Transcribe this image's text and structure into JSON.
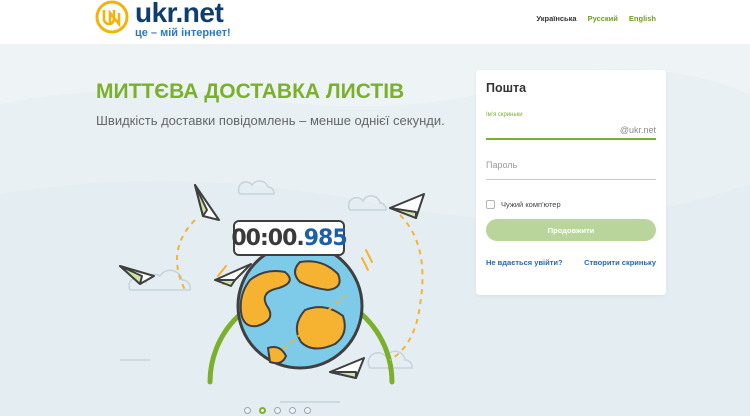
{
  "header": {
    "logo_word": "ukr.net",
    "slogan": "це – мій інтернет!",
    "languages": [
      {
        "label": "Українська",
        "current": true
      },
      {
        "label": "Русский",
        "current": false
      },
      {
        "label": "English",
        "current": false
      }
    ]
  },
  "promo": {
    "title": "МИТТЄВА ДОСТАВКА ЛИСТІВ",
    "subtitle": "Швидкість доставки повідомлень – менше однієї секунди.",
    "timer_main": "00:00.",
    "timer_ms": "985",
    "slides_total": 5,
    "slide_active": 2
  },
  "login": {
    "title": "Пошта",
    "email_label": "Ім'я скриньки",
    "email_value": "",
    "email_placeholder": "",
    "domain": "@ukr.net",
    "password_placeholder": "Пароль",
    "remember_label": "Чужий комп'ютер",
    "submit_label": "Продовжити",
    "forgot_label": "Не вдається увійти?",
    "register_label": "Створити скриньку"
  },
  "colors": {
    "brand_green": "#7bb02c",
    "brand_blue": "#0f3d6e",
    "link_blue": "#2568b5",
    "button_disabled": "#b9d59b"
  }
}
